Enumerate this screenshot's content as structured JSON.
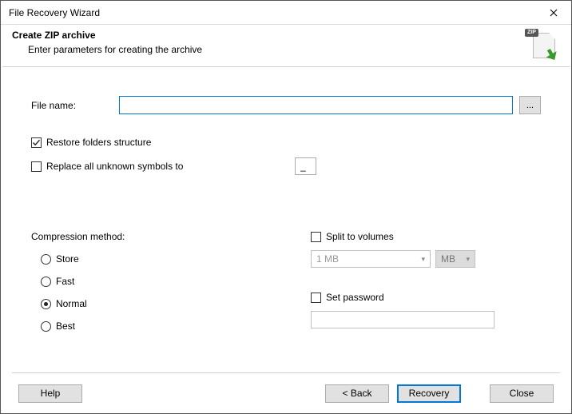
{
  "window": {
    "title": "File Recovery Wizard"
  },
  "header": {
    "title": "Create ZIP archive",
    "subtitle": "Enter parameters for creating the archive",
    "zip_badge": "ZIP"
  },
  "file": {
    "label": "File name:",
    "value": "",
    "browse": "..."
  },
  "options": {
    "restore_label": "Restore folders structure",
    "restore_checked": true,
    "replace_label": "Replace all unknown symbols to",
    "replace_checked": false,
    "replace_value": "_"
  },
  "compression": {
    "label": "Compression method:",
    "radios": {
      "store": "Store",
      "fast": "Fast",
      "normal": "Normal",
      "best": "Best"
    },
    "selected": "normal"
  },
  "split": {
    "label": "Split to volumes",
    "checked": false,
    "size": "1 MB",
    "unit": "MB"
  },
  "password": {
    "label": "Set password",
    "checked": false,
    "value": ""
  },
  "buttons": {
    "help": "Help",
    "back": "< Back",
    "recovery": "Recovery",
    "close": "Close"
  }
}
